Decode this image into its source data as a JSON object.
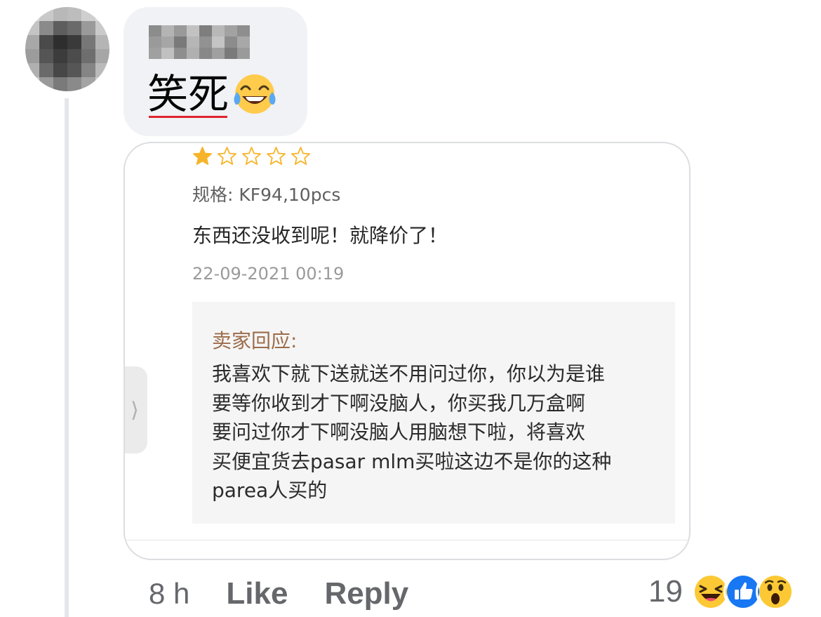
{
  "comment": {
    "author_name": "",
    "text": "笑死",
    "emoji": "face-with-tears-of-joy"
  },
  "attachment": {
    "rating": {
      "value": 1,
      "max": 5,
      "star_color": "#f6b42a"
    },
    "spec": "规格: KF94,10pcs",
    "review": "东西还没收到呢！就降价了！",
    "date": "22-09-2021 00:19",
    "seller_label": "卖家回应:",
    "seller_reply": "我喜欢下就下送就送不用问过你，你以为是谁\n要等你收到才下啊没脑人，你买我几万盒啊\n要问过你才下啊没脑人用脑想下啦，将喜欢\n买便宜货去pasar mlm买啦这边不是你的这种\nparea人买的",
    "side_arrow": "⟩"
  },
  "actions": {
    "time": "8 h",
    "like_label": "Like",
    "reply_label": "Reply"
  },
  "reactions": {
    "count": "19",
    "icons": [
      "haha-icon",
      "like-icon",
      "wow-icon"
    ]
  },
  "colors": {
    "bubble": "#f0f2f5",
    "meta_text": "#65676b",
    "seller_label": "#9c6c4a",
    "like_blue": "#1877f2"
  }
}
